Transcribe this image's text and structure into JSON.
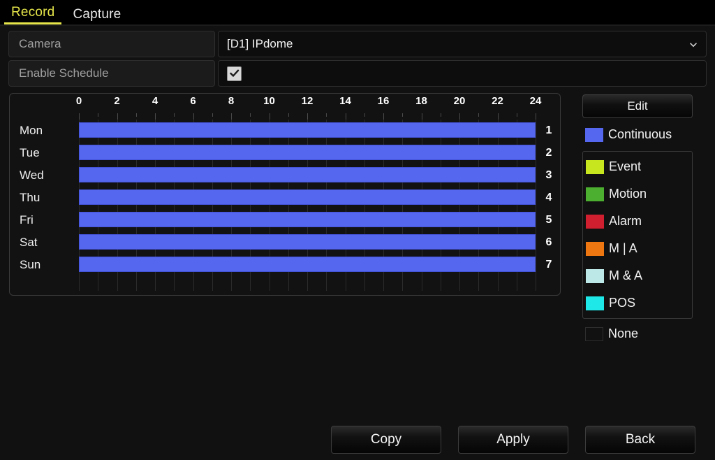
{
  "tabs": [
    {
      "label": "Record",
      "active": true
    },
    {
      "label": "Capture",
      "active": false
    }
  ],
  "form": {
    "camera": {
      "label": "Camera",
      "value": "[D1] IPdome",
      "icon": "chevron-down-icon"
    },
    "enable_schedule": {
      "label": "Enable Schedule",
      "checked": true
    }
  },
  "schedule": {
    "hour_labels": [
      "0",
      "2",
      "4",
      "6",
      "8",
      "10",
      "12",
      "14",
      "16",
      "18",
      "20",
      "22",
      "24"
    ],
    "days": [
      {
        "name": "Mon",
        "number": "1"
      },
      {
        "name": "Tue",
        "number": "2"
      },
      {
        "name": "Wed",
        "number": "3"
      },
      {
        "name": "Thu",
        "number": "4"
      },
      {
        "name": "Fri",
        "number": "5"
      },
      {
        "name": "Sat",
        "number": "6"
      },
      {
        "name": "Sun",
        "number": "7"
      }
    ],
    "segments": [
      {
        "day": "Mon",
        "start": 0,
        "end": 24,
        "type": "Continuous"
      },
      {
        "day": "Tue",
        "start": 0,
        "end": 24,
        "type": "Continuous"
      },
      {
        "day": "Wed",
        "start": 0,
        "end": 24,
        "type": "Continuous"
      },
      {
        "day": "Thu",
        "start": 0,
        "end": 24,
        "type": "Continuous"
      },
      {
        "day": "Fri",
        "start": 0,
        "end": 24,
        "type": "Continuous"
      },
      {
        "day": "Sat",
        "start": 0,
        "end": 24,
        "type": "Continuous"
      },
      {
        "day": "Sun",
        "start": 0,
        "end": 24,
        "type": "Continuous"
      }
    ]
  },
  "legend": {
    "edit_label": "Edit",
    "continuous": {
      "label": "Continuous",
      "color": "#5566ef"
    },
    "types": [
      {
        "label": "Event",
        "color": "#c8e61e"
      },
      {
        "label": "Motion",
        "color": "#4caf2f"
      },
      {
        "label": "Alarm",
        "color": "#d01f2f"
      },
      {
        "label": "M | A",
        "color": "#ee7711"
      },
      {
        "label": "M & A",
        "color": "#bde8e8"
      },
      {
        "label": "POS",
        "color": "#1ee8e8"
      }
    ],
    "none": {
      "label": "None",
      "color": "#111111"
    }
  },
  "buttons": [
    {
      "label": "Copy"
    },
    {
      "label": "Apply"
    },
    {
      "label": "Back"
    }
  ]
}
